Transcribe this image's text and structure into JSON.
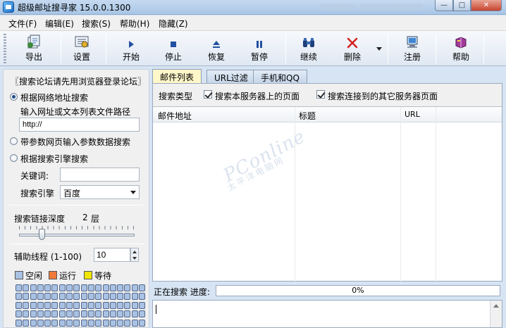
{
  "window": {
    "title": "超级邮址搜寻家 15.0.0.1300",
    "controls": {
      "minimize": "—",
      "maximize": "□",
      "close": "✕"
    }
  },
  "menu": [
    "文件(F)",
    "编辑(E)",
    "搜索(S)",
    "帮助(H)",
    "隐藏(Z)"
  ],
  "toolbar": {
    "export": "导出",
    "settings": "设置",
    "start": "开始",
    "stop": "停止",
    "restore": "恢复",
    "pause": "暂停",
    "continue": "继续",
    "delete": "删除",
    "register": "注册",
    "help": "帮助"
  },
  "left": {
    "notice": "〖搜索论坛请先用浏览器登录论坛〗",
    "opt_url": "根据网络地址搜索",
    "url_hint": "输入网址或文本列表文件路径",
    "url_value": "http://",
    "opt_param": "带参数网页输入参数数据搜索",
    "opt_engine": "根据搜索引擎搜索",
    "keyword_label": "关键词:",
    "keyword_value": "",
    "engine_label": "搜索引擎",
    "engine_value": "百度",
    "depth_label": "搜索链接深度",
    "depth_value": "2",
    "depth_unit": "层",
    "depth_level": 0.2,
    "threads_label": "辅助线程 (1-100)",
    "threads_value": "10",
    "legend": {
      "idle": "空闲",
      "running": "运行",
      "waiting": "等待"
    },
    "legend_colors": {
      "idle": "#a9c2e4",
      "running": "#f07a3a",
      "waiting": "#f2e500"
    }
  },
  "tabs": [
    "邮件列表",
    "URL过滤",
    "手机和QQ"
  ],
  "panel": {
    "search_type_label": "搜索类型",
    "check_this_server": "搜索本服务器上的页面",
    "check_other_servers": "搜索连接到的其它服务器页面",
    "columns": [
      "邮件地址",
      "标题",
      "URL"
    ],
    "watermark": "PConline",
    "watermark_sub": "太平洋电脑网"
  },
  "status": {
    "label": "正在搜索  进度:",
    "progress_text": "0%",
    "progress": 0
  }
}
